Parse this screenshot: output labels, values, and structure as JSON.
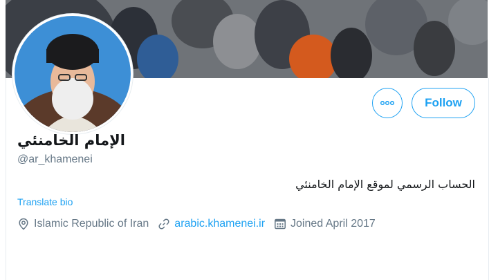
{
  "colors": {
    "accent": "#1da1f2",
    "text": "#14171a",
    "secondary": "#657786"
  },
  "profile": {
    "name": "الإمام الخامنئي",
    "handle": "@ar_khamenei",
    "bio": "الحساب الرسمي لموقع الإمام الخامنئي",
    "translate_label": "Translate bio"
  },
  "actions": {
    "follow_label": "Follow",
    "more_icon": "more-horizontal-icon"
  },
  "meta": {
    "location": "Islamic Republic of Iran",
    "location_icon": "location-pin-icon",
    "website": "arabic.khamenei.ir",
    "website_icon": "link-icon",
    "joined": "Joined April 2017",
    "joined_icon": "calendar-icon"
  }
}
